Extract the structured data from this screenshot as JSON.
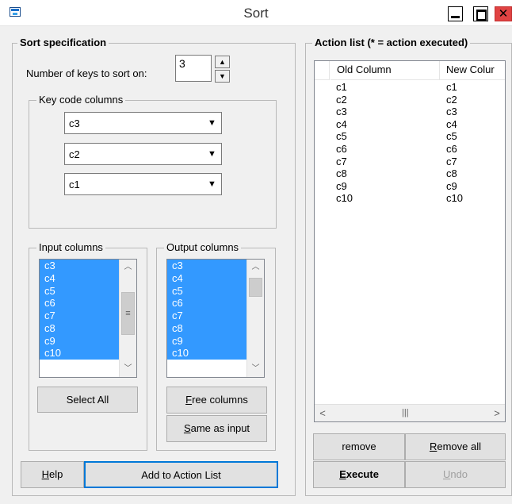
{
  "window": {
    "title": "Sort"
  },
  "sort_spec": {
    "legend": "Sort specification",
    "num_keys_label": "Number of keys to sort on:",
    "num_keys_value": "3",
    "key_code": {
      "legend": "Key code columns",
      "keys": [
        "c3",
        "c2",
        "c1"
      ]
    },
    "input_columns": {
      "legend": "Input columns",
      "items": [
        "c3",
        "c4",
        "c5",
        "c6",
        "c7",
        "c8",
        "c9",
        "c10"
      ]
    },
    "output_columns": {
      "legend": "Output columns",
      "items": [
        "c3",
        "c4",
        "c5",
        "c6",
        "c7",
        "c8",
        "c9",
        "c10"
      ]
    },
    "select_all_label": "Select All",
    "free_columns_label": {
      "first": "F",
      "rest": "ree columns"
    },
    "same_as_input_label": {
      "first": "S",
      "rest": "ame as input"
    },
    "help_label": {
      "first": "H",
      "rest": "elp"
    },
    "add_to_action_label": "Add to Action List"
  },
  "action_list": {
    "legend": "Action list (* = action executed)",
    "headers": [
      "Old Column",
      "New Colur"
    ],
    "rows": [
      [
        "c1",
        "c1"
      ],
      [
        "c2",
        "c2"
      ],
      [
        "c3",
        "c3"
      ],
      [
        "c4",
        "c4"
      ],
      [
        "c5",
        "c5"
      ],
      [
        "c6",
        "c6"
      ],
      [
        "c7",
        "c7"
      ],
      [
        "c8",
        "c8"
      ],
      [
        "c9",
        "c9"
      ],
      [
        "c10",
        "c10"
      ]
    ],
    "remove_label": "remove",
    "remove_all_label": {
      "first": "R",
      "rest": "emove all"
    },
    "execute_label": {
      "first": "E",
      "rest": "xecute"
    },
    "undo_label": {
      "first": "U",
      "rest": "ndo"
    }
  },
  "icons": {
    "app": "app-icon",
    "minimize": "minimize-icon",
    "maximize": "maximize-icon",
    "close": "close-icon",
    "spin_up": "chevron-up-icon",
    "spin_down": "chevron-down-icon",
    "dropdown": "dropdown-arrow-icon"
  },
  "colors": {
    "selection": "#3399ff",
    "close_button": "#e04343",
    "window_bg": "#f0f0f0"
  }
}
